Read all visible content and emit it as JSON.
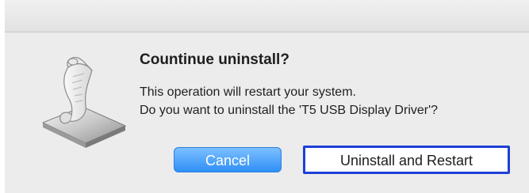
{
  "dialog": {
    "title": "Countinue uninstall?",
    "message_line1": "This operation will restart your system.",
    "message_line2": "Do you want to uninstall the 'T5 USB Display Driver'?",
    "icon": "script-scroll-icon"
  },
  "buttons": {
    "cancel_label": "Cancel",
    "confirm_label": "Uninstall and Restart"
  },
  "colors": {
    "dialog_background": "#ececec",
    "cancel_button": "#2f8ff6",
    "highlight_border": "#1e3fd8"
  }
}
